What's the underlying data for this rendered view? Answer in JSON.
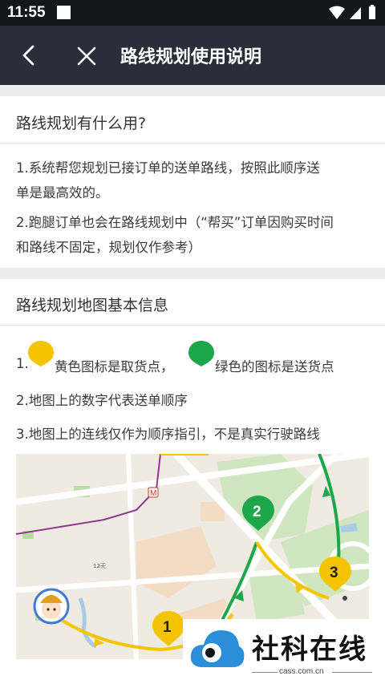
{
  "status_bar": {
    "time": "11:55"
  },
  "nav": {
    "title": "路线规划使用说明"
  },
  "section1": {
    "heading": "路线规划有什么用?",
    "para1_line1": "1.系统帮您规划已接订单的送单路线，按照此顺序送",
    "para1_line2": "单是最高效的。",
    "para2_line1": "2.跑腿订单也会在路线规划中（“帮买”订单因购买时间",
    "para2_line2": "和路线不固定，规划仅作参考）"
  },
  "section2": {
    "heading": "路线规划地图基本信息",
    "item1_prefix": "1.",
    "item1_yellow": "黄色图标是取货点，",
    "item1_green": "绿色的图标是送货点",
    "item2": "2.地图上的数字代表送单顺序",
    "item3": "3.地图上的连线仅作为顺序指引，不是真实行驶路线"
  },
  "map": {
    "markers": [
      {
        "label": "1",
        "color": "#f5c400"
      },
      {
        "label": "2",
        "color": "#1ea64a"
      },
      {
        "label": "3",
        "color": "#f5c400"
      }
    ],
    "metro_label": "M",
    "small_label": "12天"
  },
  "watermark": {
    "brand": "社科在线",
    "url": "cass.com.cn"
  },
  "colors": {
    "nav_bg": "#2a2e39",
    "status_bg": "#14161a",
    "yellow": "#f5c400",
    "green": "#1ea64a"
  }
}
